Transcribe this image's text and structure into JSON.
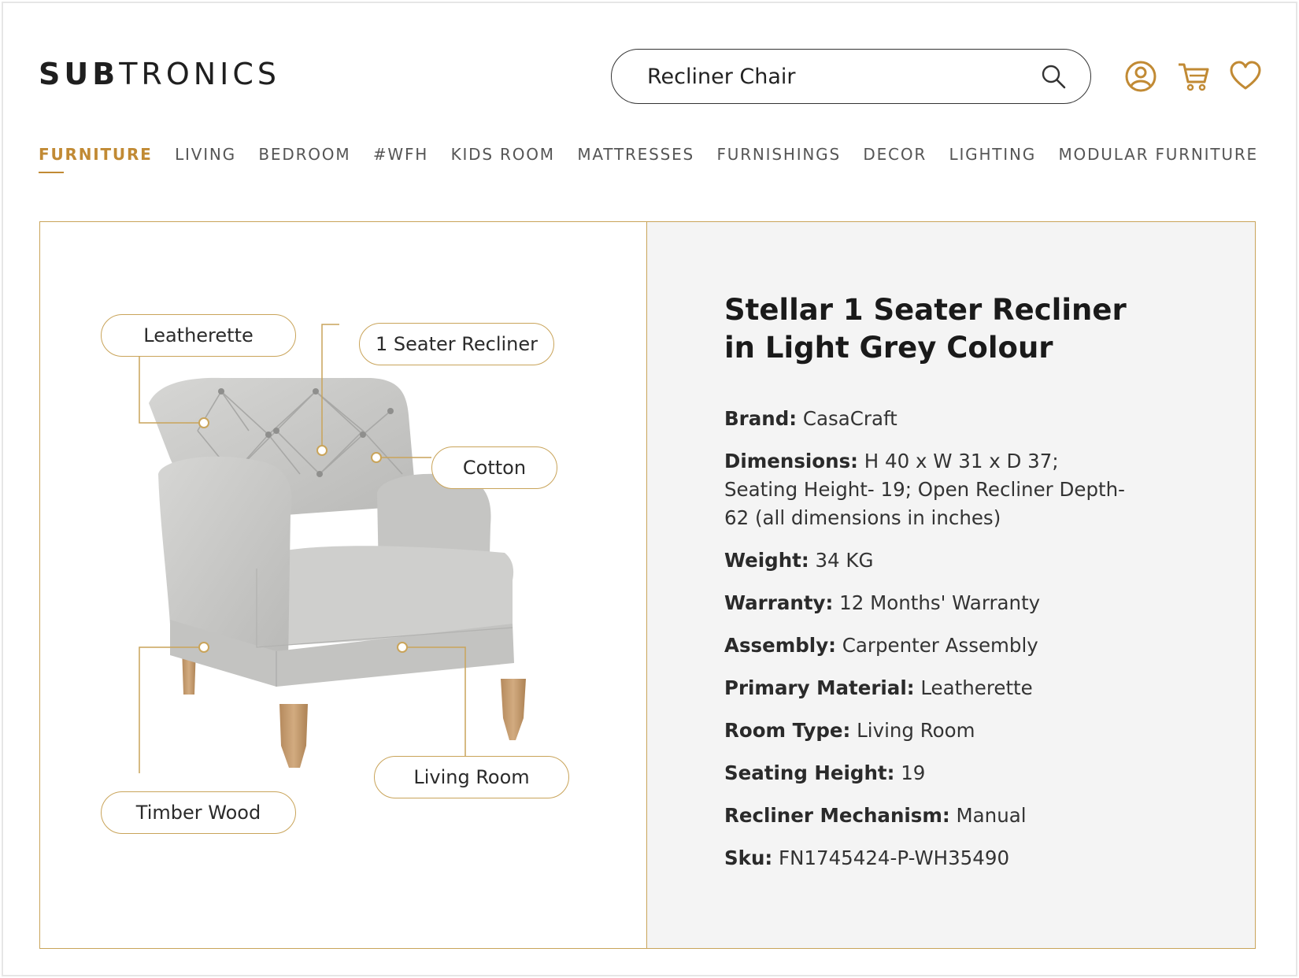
{
  "header": {
    "logo_bold": "SUB",
    "logo_light": "TRONICS",
    "search_value": "Recliner Chair",
    "icons": [
      "search-icon",
      "user-icon",
      "cart-icon",
      "heart-icon"
    ]
  },
  "nav": [
    {
      "label": "FURNITURE",
      "active": true
    },
    {
      "label": "LIVING"
    },
    {
      "label": "BEDROOM"
    },
    {
      "label": "#WFH"
    },
    {
      "label": "KIDS ROOM"
    },
    {
      "label": "MATTRESSES"
    },
    {
      "label": "FURNISHINGS"
    },
    {
      "label": "DECOR"
    },
    {
      "label": "LIGHTING"
    },
    {
      "label": "MODULAR FURNITURE"
    }
  ],
  "callouts": {
    "leatherette": "Leatherette",
    "seater": "1 Seater Recliner",
    "cotton": "Cotton",
    "timber": "Timber Wood",
    "living": "Living Room"
  },
  "product": {
    "title": "Stellar 1 Seater Recliner in Light Grey Colour",
    "specs": [
      {
        "key": "Brand:",
        "value": "CasaCraft"
      },
      {
        "key": "Dimensions:",
        "value": "H 40 x W 31 x D 37; Seating Height- 19; Open Recliner Depth-62 (all dimensions in inches)"
      },
      {
        "key": "Weight:",
        "value": "34 KG"
      },
      {
        "key": "Warranty:",
        "value": "12 Months' Warranty"
      },
      {
        "key": "Assembly:",
        "value": "Carpenter Assembly"
      },
      {
        "key": "Primary Material:",
        "value": "Leatherette"
      },
      {
        "key": "Room Type:",
        "value": "Living Room"
      },
      {
        "key": "Seating Height:",
        "value": "19"
      },
      {
        "key": "Recliner Mechanism:",
        "value": "Manual"
      },
      {
        "key": "Sku:",
        "value": "FN1745424-P-WH35490"
      }
    ]
  },
  "colors": {
    "accent": "#c18a34",
    "border": "#c9a45a",
    "panel_bg": "#f4f4f4",
    "chair": "#c9c9c7",
    "wood": "#c49a6c"
  }
}
